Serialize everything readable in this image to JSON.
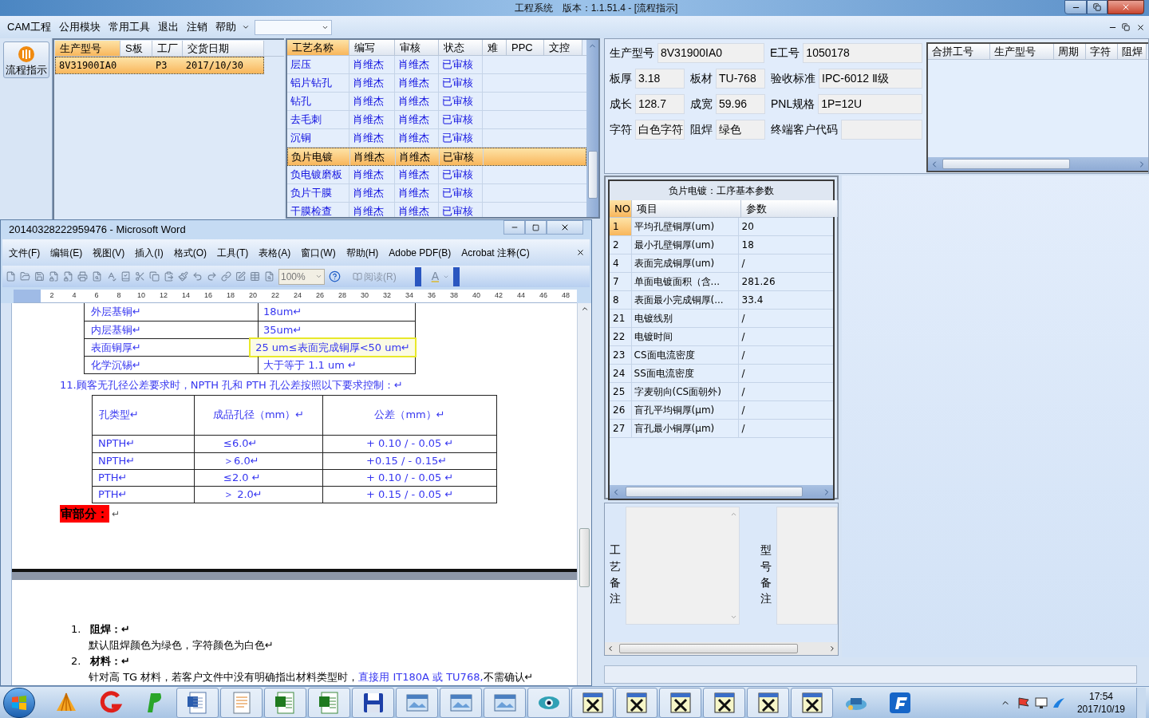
{
  "window": {
    "title": "工程系统　版本：1.1.51.4 - [流程指示]"
  },
  "menu": {
    "items": [
      "CAM工程",
      "公用模块",
      "常用工具",
      "退出",
      "注销",
      "帮助"
    ]
  },
  "sidebar": {
    "button": "流程指示"
  },
  "orders": {
    "columns": [
      {
        "label": "生产型号",
        "selected": true
      },
      {
        "label": "S板",
        "selected": false
      },
      {
        "label": "工厂",
        "selected": false
      },
      {
        "label": "交货日期",
        "selected": false
      }
    ],
    "rows": [
      {
        "production_model": "8V31900IA0",
        "factory": "P3",
        "delivery_date": "2017/10/30",
        "selected": true
      }
    ]
  },
  "processes": {
    "columns": [
      {
        "label": "工艺名称",
        "selected": true
      },
      {
        "label": "编写",
        "selected": false
      },
      {
        "label": "审核",
        "selected": false
      },
      {
        "label": "状态",
        "selected": false
      },
      {
        "label": "难",
        "selected": false
      },
      {
        "label": "PPC",
        "selected": false
      },
      {
        "label": "文控",
        "selected": false
      }
    ],
    "rows": [
      {
        "name": "层压",
        "writer": "肖维杰",
        "reviewer": "肖维杰",
        "status": "已审核",
        "selected": false
      },
      {
        "name": "铝片钻孔",
        "writer": "肖维杰",
        "reviewer": "肖维杰",
        "status": "已审核",
        "selected": false
      },
      {
        "name": "钻孔",
        "writer": "肖维杰",
        "reviewer": "肖维杰",
        "status": "已审核",
        "selected": false
      },
      {
        "name": "去毛刺",
        "writer": "肖维杰",
        "reviewer": "肖维杰",
        "status": "已审核",
        "selected": false
      },
      {
        "name": "沉铜",
        "writer": "肖维杰",
        "reviewer": "肖维杰",
        "status": "已审核",
        "selected": false
      },
      {
        "name": "负片电镀",
        "writer": "肖维杰",
        "reviewer": "肖维杰",
        "status": "已审核",
        "selected": true
      },
      {
        "name": "负电镀磨板",
        "writer": "肖维杰",
        "reviewer": "肖维杰",
        "status": "已审核",
        "selected": false
      },
      {
        "name": "负片干膜",
        "writer": "肖维杰",
        "reviewer": "肖维杰",
        "status": "已审核",
        "selected": false
      },
      {
        "name": "干膜检查",
        "writer": "肖维杰",
        "reviewer": "肖维杰",
        "status": "已审核",
        "selected": false
      }
    ]
  },
  "details": {
    "rows": [
      [
        {
          "label": "生产型号",
          "value": "8V31900IA0"
        },
        "",
        {
          "label": "E工号",
          "value": "1050178"
        }
      ],
      [
        {
          "label": "板厚",
          "value": "3.18"
        },
        {
          "label": "板材",
          "value": "TU-768"
        },
        {
          "label": "验收标准",
          "value": "IPC-6012 Ⅱ级"
        }
      ],
      [
        {
          "label": "成长",
          "value": "128.7"
        },
        {
          "label": "成宽",
          "value": "59.96"
        },
        {
          "label": "PNL规格",
          "value": "1P=12U"
        }
      ],
      [
        {
          "label": "字符",
          "value": "白色字符"
        },
        {
          "label": "阻焊",
          "value": "绿色"
        },
        {
          "label": "终端客户代码"
        }
      ]
    ]
  },
  "merge_table": {
    "columns": [
      "合拼工号",
      "生产型号",
      "周期",
      "字符",
      "阻焊"
    ]
  },
  "params": {
    "title": "负片电镀：工序基本参数",
    "columns": [
      {
        "label": "NO",
        "selected": true
      },
      {
        "label": "项目",
        "selected": false
      },
      {
        "label": "参数",
        "selected": false
      }
    ],
    "rows": [
      {
        "no": "1",
        "item": "平均孔壁铜厚(um)",
        "value": "20",
        "selected": true
      },
      {
        "no": "2",
        "item": "最小孔壁铜厚(um)",
        "value": "18",
        "selected": false
      },
      {
        "no": "4",
        "item": "表面完成铜厚(um)",
        "value": "/",
        "selected": false
      },
      {
        "no": "7",
        "item": "单面电镀面积（含...",
        "value": "281.26",
        "selected": false
      },
      {
        "no": "8",
        "item": "表面最小完成铜厚(...",
        "value": "33.4",
        "selected": false
      },
      {
        "no": "21",
        "item": "电镀线别",
        "value": "/",
        "selected": false
      },
      {
        "no": "22",
        "item": "电镀时间",
        "value": "/",
        "selected": false
      },
      {
        "no": "23",
        "item": "CS面电流密度",
        "value": "/",
        "selected": false
      },
      {
        "no": "24",
        "item": "SS面电流密度",
        "value": "/",
        "selected": false
      },
      {
        "no": "25",
        "item": "字麦朝向(CS面朝外)",
        "value": "/",
        "selected": false
      },
      {
        "no": "26",
        "item": "盲孔平均铜厚(μm)",
        "value": "/",
        "selected": false
      },
      {
        "no": "27",
        "item": "盲孔最小铜厚(μm)",
        "value": "/",
        "selected": false
      }
    ]
  },
  "notes": {
    "process_label": "工艺备注",
    "model_label": "型号备注"
  },
  "word": {
    "title": "20140328222959476 - Microsoft Word",
    "menu": [
      "文件(F)",
      "编辑(E)",
      "视图(V)",
      "插入(I)",
      "格式(O)",
      "工具(T)",
      "表格(A)",
      "窗口(W)",
      "帮助(H)",
      "Adobe PDF(B)",
      "Acrobat 注释(C)"
    ],
    "zoom": "100%",
    "read_button": "阅读(R)",
    "font_color_button": "A",
    "ruler": [
      "2",
      "4",
      "6",
      "8",
      "10",
      "12",
      "14",
      "16",
      "18",
      "20",
      "22",
      "24",
      "26",
      "28",
      "30",
      "32",
      "34",
      "36",
      "38",
      "40",
      "42",
      "44",
      "46",
      "48"
    ],
    "doc": {
      "table1": [
        {
          "label": "外层基铜↵",
          "value": "18um↵",
          "highlighted": false
        },
        {
          "label": "内层基铜↵",
          "value": "35um↵",
          "highlighted": false
        },
        {
          "label": "表面铜厚↵",
          "value": "25 um≤表面完成铜厚<50 um↵",
          "highlighted": true
        },
        {
          "label": "化学沉锡↵",
          "value": "大于等于 1.1 um  ↵",
          "highlighted": false
        }
      ],
      "paragraph": "11.顾客无孔径公差要求时，NPTH 孔和 PTH 孔公差按照以下要求控制：↵",
      "table2": {
        "columns": [
          "孔类型↵",
          "成品孔径（mm）↵",
          "公差（mm）↵"
        ],
        "rows": [
          [
            "NPTH↵",
            "≤6.0↵",
            "+ 0.10 / - 0.05 ↵"
          ],
          [
            "NPTH↵",
            "＞6.0↵",
            "+0.15 / - 0.15↵"
          ],
          [
            "PTH↵",
            "≤2.0 ↵",
            "+ 0.10 / - 0.05 ↵"
          ],
          [
            "PTH↵",
            "＞ 2.0↵",
            "+ 0.15 / - 0.05 ↵"
          ]
        ]
      },
      "heading": "审部分：",
      "heading_mark": "↵",
      "list": [
        {
          "number": "1.",
          "title": "阻焊：↵",
          "lines": [
            [
              {
                "kind": "plain",
                "text": "默认阻焊颜色为绿色，字符颜色为白色↵"
              }
            ]
          ]
        },
        {
          "number": "2.",
          "title": "材料：↵",
          "lines": [
            [
              {
                "kind": "plain",
                "text": "针对高 TG 材料，若客户文件中没有明确指出材料类型时，"
              },
              {
                "kind": "emphasis",
                "text": "直接用 IT180A 或 TU768,"
              },
              {
                "kind": "plain",
                "text": "不需确认↵"
              }
            ]
          ]
        }
      ]
    }
  },
  "taskbar": {
    "time": "17:54",
    "date": "2017/10/19"
  }
}
